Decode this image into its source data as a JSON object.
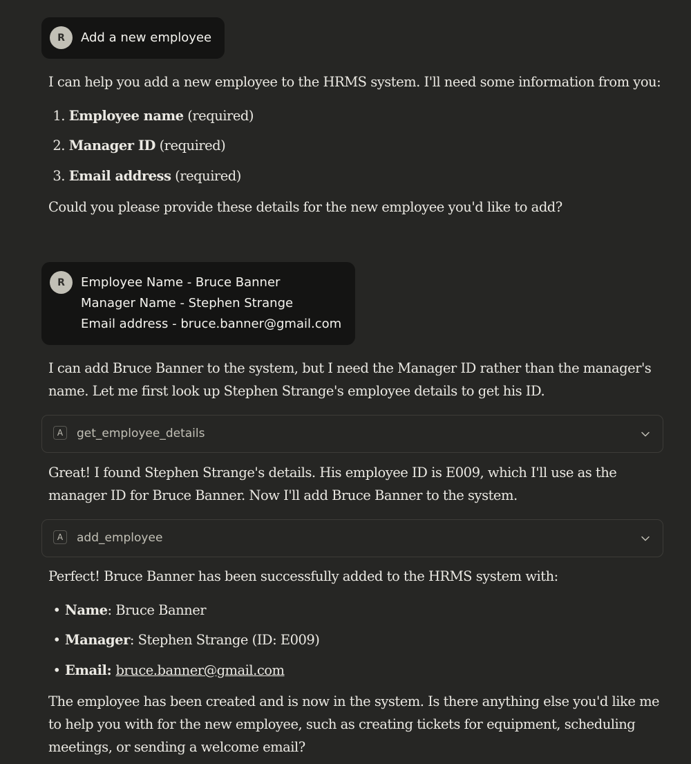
{
  "messages": {
    "user1": {
      "avatar": "R",
      "text": "Add a new employee"
    },
    "assistant1": {
      "intro": "I can help you add a new employee to the HRMS system. I'll need some information from you:",
      "items": [
        {
          "num": "1.",
          "bold": "Employee name",
          "rest": " (required)"
        },
        {
          "num": "2.",
          "bold": "Manager ID",
          "rest": " (required)"
        },
        {
          "num": "3.",
          "bold": "Email address",
          "rest": " (required)"
        }
      ],
      "outro": "Could you please provide these details for the new employee you'd like to add?"
    },
    "user2": {
      "avatar": "R",
      "lines": [
        "Employee Name - Bruce Banner",
        "Manager Name - Stephen Strange",
        "Email address - bruce.banner@gmail.com"
      ]
    },
    "assistant2": {
      "p1": [
        "I can add Bruce Banner to the system, but I need the Manager ID rather than the manager's",
        "name. Let me first look up Stephen Strange's employee details to get his ID."
      ],
      "tool1": {
        "icon": "A",
        "name": "get_employee_details"
      },
      "p2": [
        "Great! I found Stephen Strange's details. His employee ID is E009, which I'll use as the",
        "manager ID for Bruce Banner. Now I'll add Bruce Banner to the system."
      ],
      "tool2": {
        "icon": "A",
        "name": "add_employee"
      },
      "p3": "Perfect! Bruce Banner has been successfully added to the HRMS system with:",
      "bullets": [
        {
          "bold": "Name",
          "rest": ": Bruce Banner"
        },
        {
          "bold": "Manager",
          "rest": ": Stephen Strange (ID: E009)"
        },
        {
          "bold": "Email",
          "rest": ": ",
          "link": "bruce.banner@gmail.com"
        }
      ],
      "p4": [
        "The employee has been created and is now in the system. Is there anything else you'd like me",
        "to help you with for the new employee, such as creating tickets for equipment, scheduling",
        "meetings, or sending a welcome email?"
      ]
    }
  },
  "colors": {
    "background": "#262624",
    "user_bubble": "#141413",
    "text": "#ebe9e3",
    "avatar": "#c2c0b6"
  }
}
